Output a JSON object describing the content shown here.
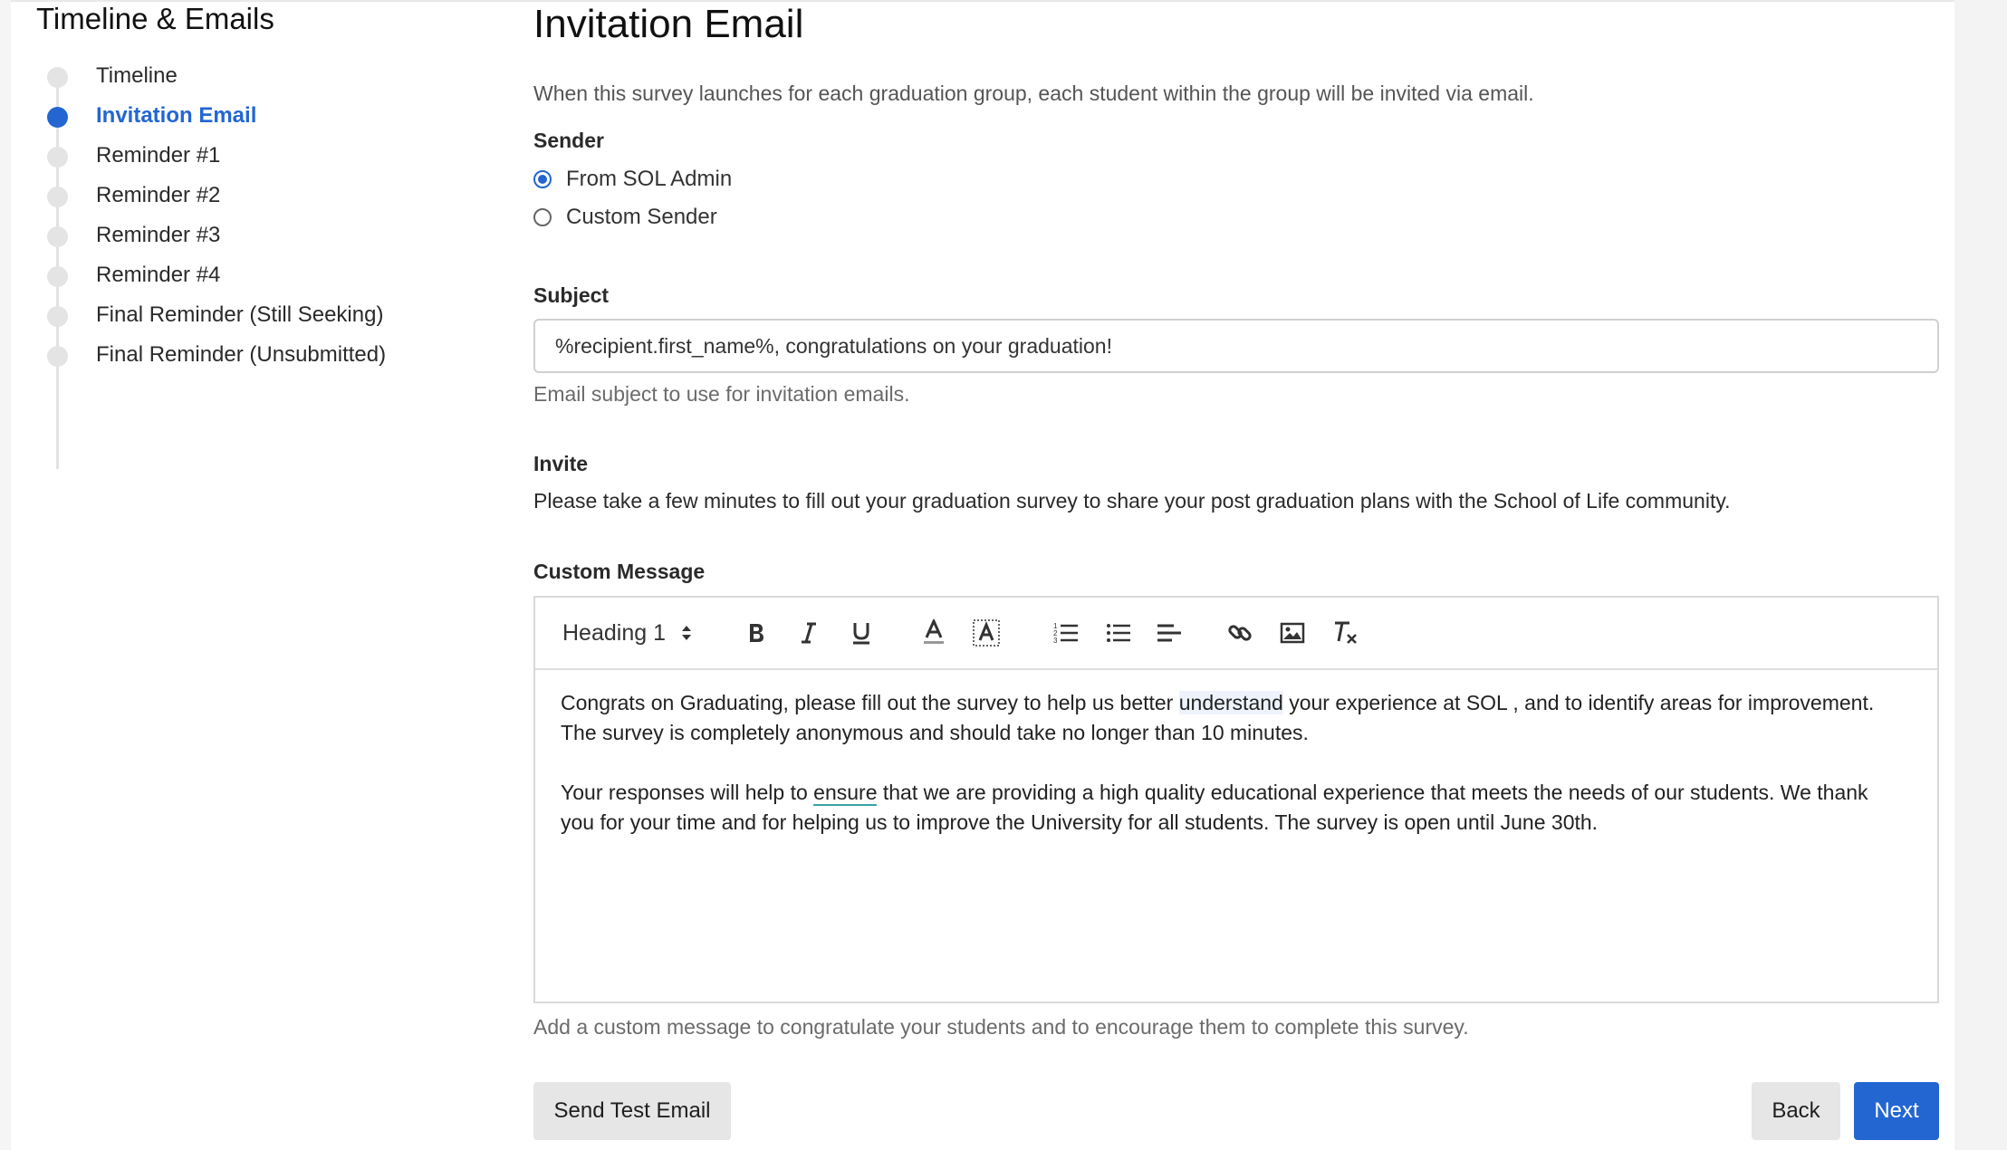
{
  "sidebar": {
    "title": "Timeline & Emails",
    "steps": [
      {
        "label": "Timeline"
      },
      {
        "label": "Invitation Email"
      },
      {
        "label": "Reminder #1"
      },
      {
        "label": "Reminder #2"
      },
      {
        "label": "Reminder #3"
      },
      {
        "label": "Reminder #4"
      },
      {
        "label": "Final Reminder (Still Seeking)"
      },
      {
        "label": "Final Reminder (Unsubmitted)"
      }
    ],
    "active_step": "Invitation Email"
  },
  "main": {
    "title": "Invitation Email",
    "description": "When this survey launches for each graduation group, each student within the group will be invited via email.",
    "sender": {
      "label": "Sender",
      "options": [
        {
          "label": "From SOL Admin",
          "checked": true
        },
        {
          "label": "Custom Sender",
          "checked": false
        }
      ]
    },
    "subject": {
      "label": "Subject",
      "value": "%recipient.first_name%, congratulations on your graduation!",
      "help": "Email subject to use for invitation emails."
    },
    "invite": {
      "label": "Invite",
      "text": "Please take a few minutes to fill out your graduation survey to share your post graduation plans with the School of Life community."
    },
    "custom_message": {
      "label": "Custom Message",
      "toolbar": {
        "block_format": "Heading 1",
        "icons": [
          "bold-icon",
          "italic-icon",
          "underline-icon",
          "font-color-icon",
          "highlight-icon",
          "ordered-list-icon",
          "bullet-list-icon",
          "align-icon",
          "link-icon",
          "image-icon",
          "clear-format-icon"
        ]
      },
      "paragraph1_part1": "Congrats on Graduating, please fill out the survey to help us better ",
      "paragraph1_word": "understand",
      "paragraph1_part2": " your experience at SOL , and to identify areas for improvement. The survey is completely anonymous and should take no longer than 10 minutes.",
      "paragraph2_part1": "Your responses will help to ",
      "paragraph2_word": "ensure",
      "paragraph2_part2": " that we are providing a high quality educational experience that meets the needs of our students. We thank you for your time and for helping us to improve the University for all students. The survey is open until June 30th.",
      "help": "Add a custom message to congratulate your students and to encourage them to complete this survey."
    },
    "buttons": {
      "send_test": "Send Test Email",
      "back": "Back",
      "next": "Next"
    }
  },
  "colors": {
    "accent": "#2366d1",
    "inactive_dot": "#e4e4e4",
    "button_gray": "#e6e6e6"
  }
}
